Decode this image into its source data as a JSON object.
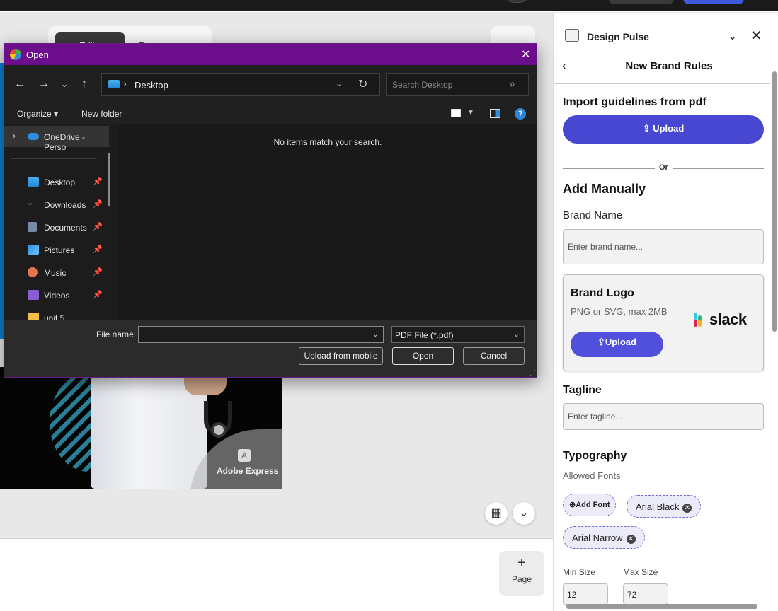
{
  "app": {
    "edit_page_label": "Edit page",
    "resize_label": "Resize",
    "watermark": "Adobe Express",
    "page_button_label": "Page"
  },
  "panel": {
    "title": "Design Pulse",
    "subtitle": "New Brand Rules",
    "import_heading": "Import guidelines from pdf",
    "upload_label": "Upload",
    "or_label": "Or",
    "add_manually_heading": "Add Manually",
    "brand_name_label": "Brand Name",
    "brand_name_placeholder": "Enter brand name...",
    "brand_logo_heading": "Brand Logo",
    "brand_logo_hint": "PNG or SVG, max 2MB",
    "brand_logo_upload_label": "Upload",
    "brand_logo_preview_text": "slack",
    "tagline_label": "Tagline",
    "tagline_placeholder": "Enter tagline...",
    "typography_heading": "Typography",
    "allowed_fonts_label": "Allowed Fonts",
    "add_font_label": "Add Font",
    "fonts": [
      "Arial Black",
      "Arial Narrow"
    ],
    "min_size_label": "Min Size",
    "max_size_label": "Max Size",
    "min_size_value": "12",
    "max_size_value": "72"
  },
  "dialog": {
    "title": "Open",
    "location": "Desktop",
    "search_placeholder": "Search Desktop",
    "organize_label": "Organize",
    "new_folder_label": "New folder",
    "help_glyph": "?",
    "empty_message": "No items match your search.",
    "sidebar": [
      {
        "label": "OneDrive - Perso",
        "icon": "cloud-icon"
      },
      {
        "label": "Desktop",
        "icon": "desktop-folder-icon",
        "pinned": true
      },
      {
        "label": "Downloads",
        "icon": "download-icon",
        "pinned": true
      },
      {
        "label": "Documents",
        "icon": "document-icon",
        "pinned": true
      },
      {
        "label": "Pictures",
        "icon": "picture-icon",
        "pinned": true
      },
      {
        "label": "Music",
        "icon": "music-icon",
        "pinned": true
      },
      {
        "label": "Videos",
        "icon": "video-icon",
        "pinned": true
      },
      {
        "label": "unit 5",
        "icon": "folder-icon"
      }
    ],
    "file_name_label": "File name:",
    "file_name_value": "",
    "file_type_value": "PDF File (*.pdf)",
    "upload_mobile_label": "Upload from mobile",
    "open_label": "Open",
    "cancel_label": "Cancel"
  },
  "colors": {
    "dialog_title_bar": "#6c0d8c",
    "panel_upload_button": "#4747d1",
    "chip_border": "#6b6bd6"
  }
}
